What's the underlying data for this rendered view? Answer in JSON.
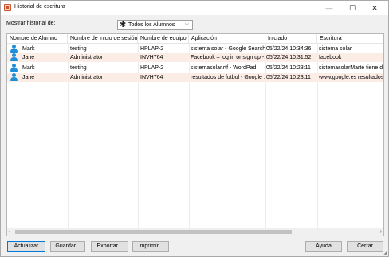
{
  "window": {
    "title": "Historial de escritura",
    "minimize_glyph": "—",
    "maximize_glyph": "☐",
    "close_glyph": "✕",
    "icon": "app-icon"
  },
  "filter": {
    "label": "Mostrar historial de:",
    "selected": "Todos los Alumnos",
    "star_glyph": "✱",
    "chevron_glyph": "⌵"
  },
  "table": {
    "columns": [
      "Nombre de Alumno",
      "Nombre de inicio de sesión",
      "Nombre de equipo",
      "Aplicación",
      "Iniciado",
      "Escritura"
    ],
    "rows": [
      [
        "Mark",
        "testing",
        "HPLAP-2",
        "sistema solar - Google Search ...",
        "05/22/24 10:34:36",
        "sistema solar"
      ],
      [
        "Jane",
        "Administrator",
        "INVH764",
        "Facebook – log in or sign up -...",
        "05/22/24 10:31:52",
        "facebook"
      ],
      [
        "Mark",
        "testing",
        "HPLAP-2",
        "sistemasolar.rtf - WordPad",
        "05/22/24 10:23:11",
        "sistemasolarMarte tiene dos"
      ],
      [
        "Jane",
        "Administrator",
        "INVH764",
        "resultados de futbol - Google ...",
        "05/22/24 10:23:11",
        "www.google.es resultados"
      ]
    ],
    "row_highlight_color": "#fbece6",
    "user_icon_color": "#1e8ed8"
  },
  "scrollbar": {
    "left_glyph": "‹",
    "right_glyph": "›"
  },
  "buttons": {
    "refresh": "Actualizar",
    "save": "Guardar...",
    "export": "Exportar...",
    "print": "Imprimir...",
    "help": "Ayuda",
    "close": "Cerrar"
  },
  "resize_grip_glyph": "◢"
}
